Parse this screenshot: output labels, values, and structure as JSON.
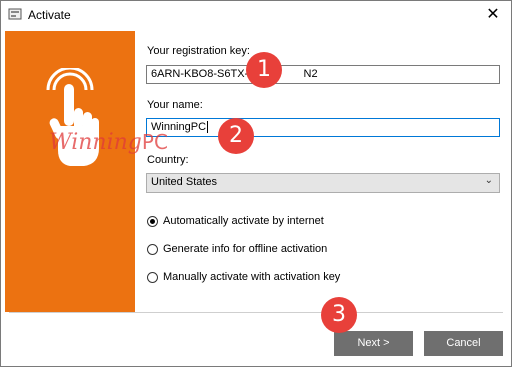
{
  "window": {
    "title": "Activate",
    "close_glyph": "✕"
  },
  "form": {
    "registration_key_label": "Your registration key:",
    "registration_key_value": "6ARN-KBO8-S6TX-E",
    "registration_key_tail": "N2",
    "name_label": "Your name:",
    "name_value": "WinningPC",
    "country_label": "Country:",
    "country_value": "United States"
  },
  "options": [
    {
      "label": "Automatically activate by internet",
      "checked": true
    },
    {
      "label": "Generate info for offline activation",
      "checked": false
    },
    {
      "label": "Manually activate with activation key",
      "checked": false
    }
  ],
  "buttons": {
    "next": "Next >",
    "cancel": "Cancel"
  },
  "badges": {
    "one": "1",
    "two": "2",
    "three": "3"
  },
  "watermark": {
    "text1": "Winning",
    "text2": "PC"
  },
  "colors": {
    "side_panel": "#ec7211",
    "badge": "#e8403a",
    "button": "#6f6f6f"
  },
  "icons": {
    "side_panel": "touch-hand-icon",
    "app": "activate-app-icon"
  }
}
